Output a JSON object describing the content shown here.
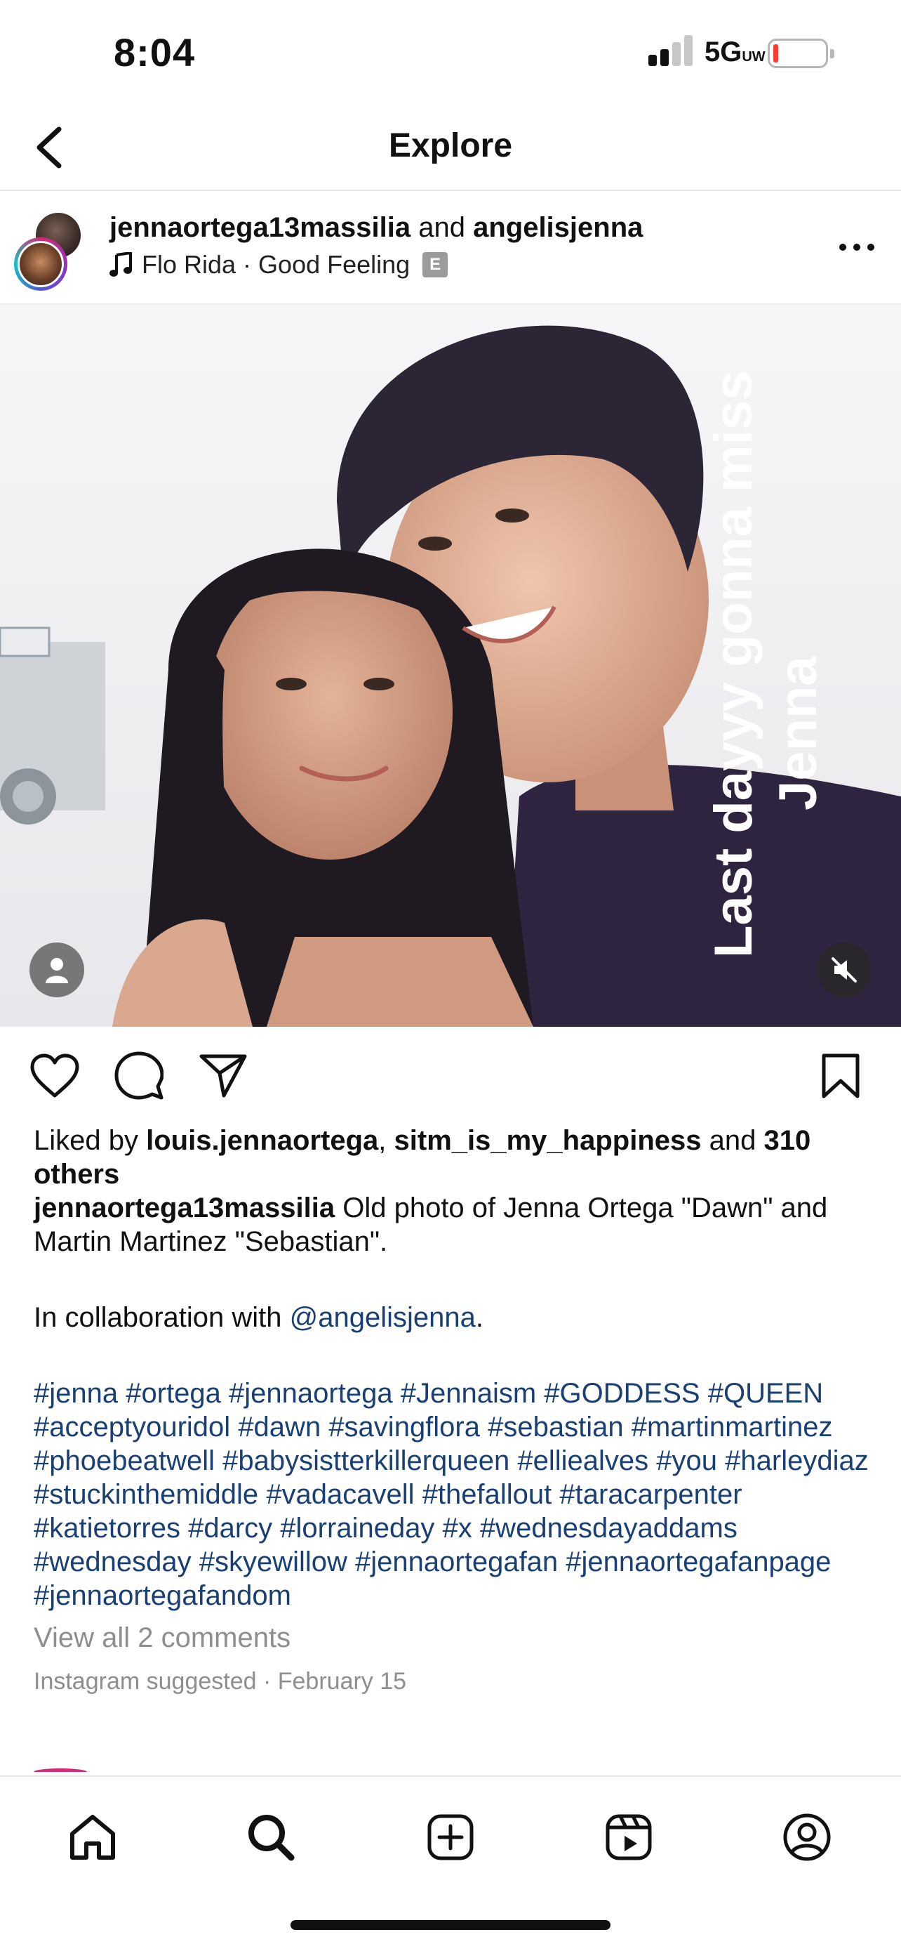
{
  "status_bar": {
    "time": "8:04",
    "network": "5G",
    "network_sup": "UW",
    "battery_color": "#ff3b30"
  },
  "header": {
    "title": "Explore",
    "back_icon": "chevron-left-icon"
  },
  "post": {
    "users_primary": "jennaortega13massilia",
    "users_joiner": " and ",
    "users_secondary": "angelisjenna",
    "audio_artist_track": "Flo Rida · Good Feeling",
    "explicit_label": "E",
    "overlay_line_1": "Last dayyy gonna miss",
    "overlay_line_2": "Jenna",
    "likes": {
      "prefix": "Liked by ",
      "user1": "louis.jennaortega",
      "sep": ", ",
      "user2": "sitm_is_my_happiness",
      "and": " and ",
      "count": "310 others"
    },
    "caption": {
      "username": "jennaortega13massilia",
      "text": " Old photo of Jenna Ortega \"Dawn\" and  Martin Martinez \"Sebastian\"."
    },
    "collab": {
      "prefix": "In collaboration with ",
      "mention": "@angelisjenna",
      "suffix": "."
    },
    "hashtags": [
      "#jenna",
      "#ortega",
      "#jennaortega",
      "#Jennaism",
      "#GODDESS",
      "#QUEEN",
      "#acceptyouridol",
      "#dawn",
      "#savingflora",
      "#sebastian",
      "#martinmartinez",
      "#phoebeatwell",
      "#babysistterkillerqueen",
      "#elliealves",
      "#you",
      "#harleydiaz",
      "#stuckinthemiddle",
      "#vadacavell",
      "#thefallout",
      "#taracarpenter",
      "#katietorres",
      "#darcy",
      "#lorraineday",
      "#x",
      "#wednesdayaddams",
      "#wednesday",
      "#skyewillow",
      "#jennaortegafan",
      "#jennaortegafanpage",
      "#jennaortegafandom"
    ],
    "view_comments": "View all 2 comments",
    "meta_source": "Instagram suggested",
    "meta_dot": " · ",
    "meta_date": "February 15"
  },
  "tab_bar": {
    "items": [
      "home-icon",
      "search-icon",
      "create-icon",
      "reels-icon",
      "profile-icon"
    ]
  },
  "colors": {
    "link": "#1a3f75",
    "muted": "#8e8e8e"
  }
}
